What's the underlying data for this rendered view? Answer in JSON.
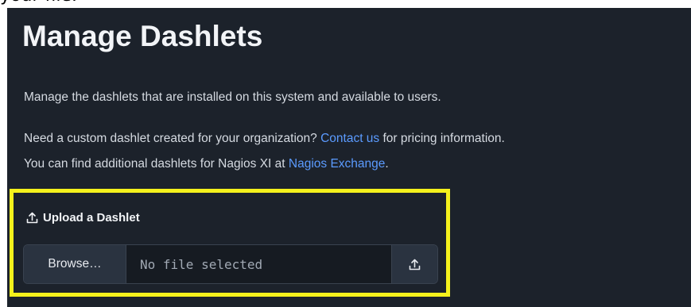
{
  "top_strip": {
    "text": "your file."
  },
  "header": {
    "title": "Manage Dashlets"
  },
  "intro": {
    "description": "Manage the dashlets that are installed on this system and available to users.",
    "custom_prefix": "Need a custom dashlet created for your organization? ",
    "contact_link": "Contact us",
    "custom_suffix": " for pricing information.",
    "exchange_prefix": "You can find additional dashlets for Nagios XI at ",
    "exchange_link": "Nagios Exchange",
    "exchange_suffix": "."
  },
  "upload": {
    "heading": "Upload a Dashlet",
    "heading_icon": "upload-icon",
    "browse_label": "Browse…",
    "file_status": "No file selected",
    "submit_icon": "upload-icon"
  },
  "colors": {
    "background": "#1c222b",
    "link": "#5b9bff",
    "highlight": "#f4f11c",
    "input_background": "#161b22",
    "button_background": "#2a3340"
  }
}
